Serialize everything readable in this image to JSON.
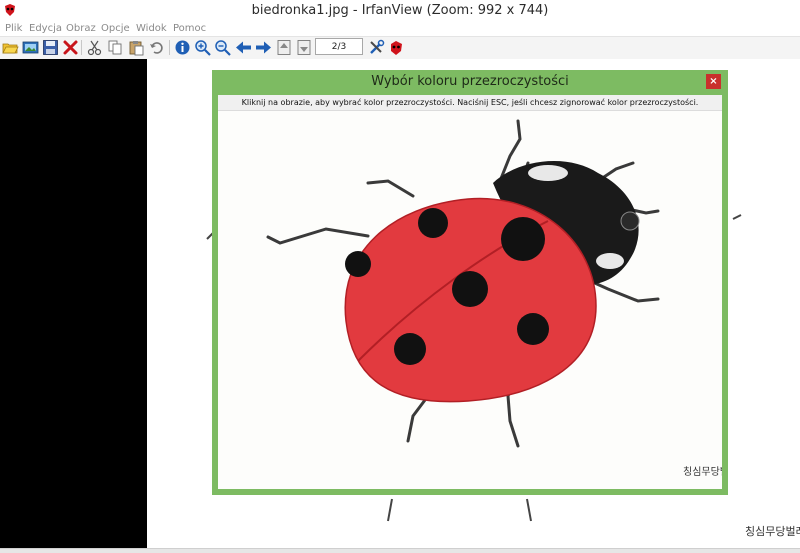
{
  "window": {
    "title": "biedronka1.jpg - IrfanView (Zoom: 992 x 744)"
  },
  "menu": {
    "items": [
      "Plik",
      "Edycja",
      "Obraz",
      "Opcje",
      "Widok",
      "Pomoc"
    ]
  },
  "toolbar": {
    "page_indicator": "2/3",
    "icons": [
      "open-folder-icon",
      "thumbnails-icon",
      "save-icon",
      "delete-icon",
      "cut-icon",
      "copy-icon",
      "paste-icon",
      "undo-icon",
      "info-icon",
      "zoom-in-icon",
      "zoom-out-icon",
      "previous-icon",
      "next-icon",
      "page-up-icon",
      "page-down-icon",
      "settings-icon",
      "irfanview-logo-icon"
    ]
  },
  "dialog": {
    "title": "Wybór koloru przezroczystości",
    "close_label": "×",
    "instruction": "Kliknij na obrazie, aby wybrać kolor przezroczystości.  Naciśnij ESC, jeśli chcesz zignorować kolor przezroczystości."
  },
  "image": {
    "subject": "ladybug-drawing",
    "signature_text": "칭심무당벌레"
  },
  "colors": {
    "dialog_frame": "#7dbb62",
    "close_button": "#c9302c",
    "ladybug_red": "#e23a3f"
  }
}
